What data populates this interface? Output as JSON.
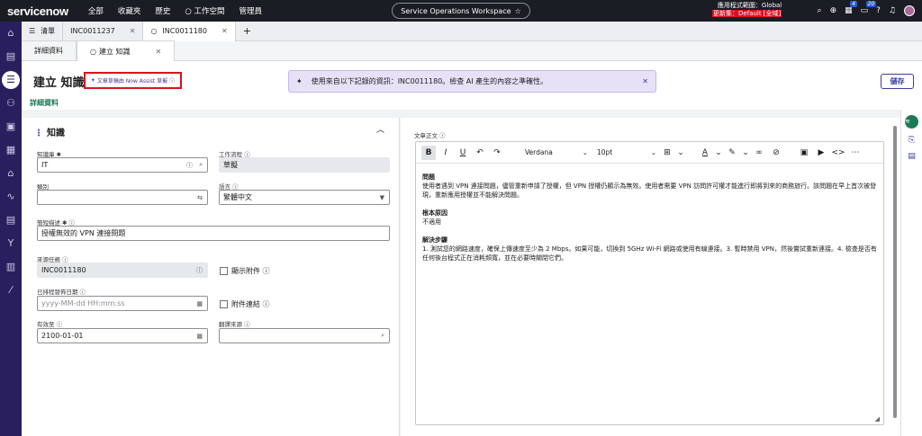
{
  "topbar": {
    "logo": "servicenow",
    "nav": [
      "全部",
      "收藏夾",
      "歷史",
      "○ 工作空間",
      "管理員"
    ],
    "workspace": "Service Operations Workspace",
    "scope_line1": "應用程式範圍：Global",
    "scope_line2": "更新集：Default [全域]",
    "badge1": "4",
    "badge2": "20"
  },
  "tabs1": [
    {
      "label": "清單",
      "icon": "list-icon"
    },
    {
      "label": "INC0011237"
    },
    {
      "label": "INC0011180"
    }
  ],
  "tabs2": [
    {
      "label": "詳細資料"
    },
    {
      "label": "建立 知識"
    }
  ],
  "header": {
    "title": "建立 知識",
    "draft_label": "文章草稿由 Now Assist 草擬",
    "banner": "使用來自以下記錄的資訊：INC0011180。檢查 AI 產生的內容之準確性。",
    "save": "儲存",
    "subtab": "詳細資料"
  },
  "form": {
    "section": "知識",
    "kb_label": "知識庫",
    "kb_value": "IT",
    "workflow_label": "工作流程",
    "workflow_value": "草擬",
    "category_label": "類別",
    "language_label": "語言",
    "language_value": "繁體中文",
    "short_desc_label": "簡短描述",
    "short_desc_value": "授權無效的 VPN 連接問題",
    "source_task_label": "來源任務",
    "source_task_value": "INC0011180",
    "show_attach_label": "顯示附件",
    "planned_label": "已排程發佈日期",
    "planned_placeholder": "yyyy-MM-dd HH:mm:ss",
    "attach_link_label": "附件連結",
    "valid_to_label": "有效至",
    "valid_to_value": "2100-01-01",
    "translated_label": "翻譯來源"
  },
  "editor": {
    "label": "文章正文",
    "font": "Verdana",
    "size": "10pt",
    "h1": "問題",
    "p1": "使用者遇到 VPN 連接問題，儘管重新申請了授權，但 VPN 授權仍顯示為無效。使用者需要 VPN 訪問許可權才能進行即將到來的商務旅行。該問題在早上首次被發現，重新應用授權並不能解決問題。",
    "h2": "根本原因",
    "p2": "不適用",
    "h3": "解決步驟",
    "p3": "1. 測試您的網路速度，確保上傳速度至少為 2 Mbps。如果可能，切換到 5GHz Wi-Fi 網路或使用有線連接。3. 暫時禁用 VPN，然後嘗試重新連接。4. 檢查是否有任何後台程式正在消耗頻寬，並在必要時關閉它們。"
  }
}
